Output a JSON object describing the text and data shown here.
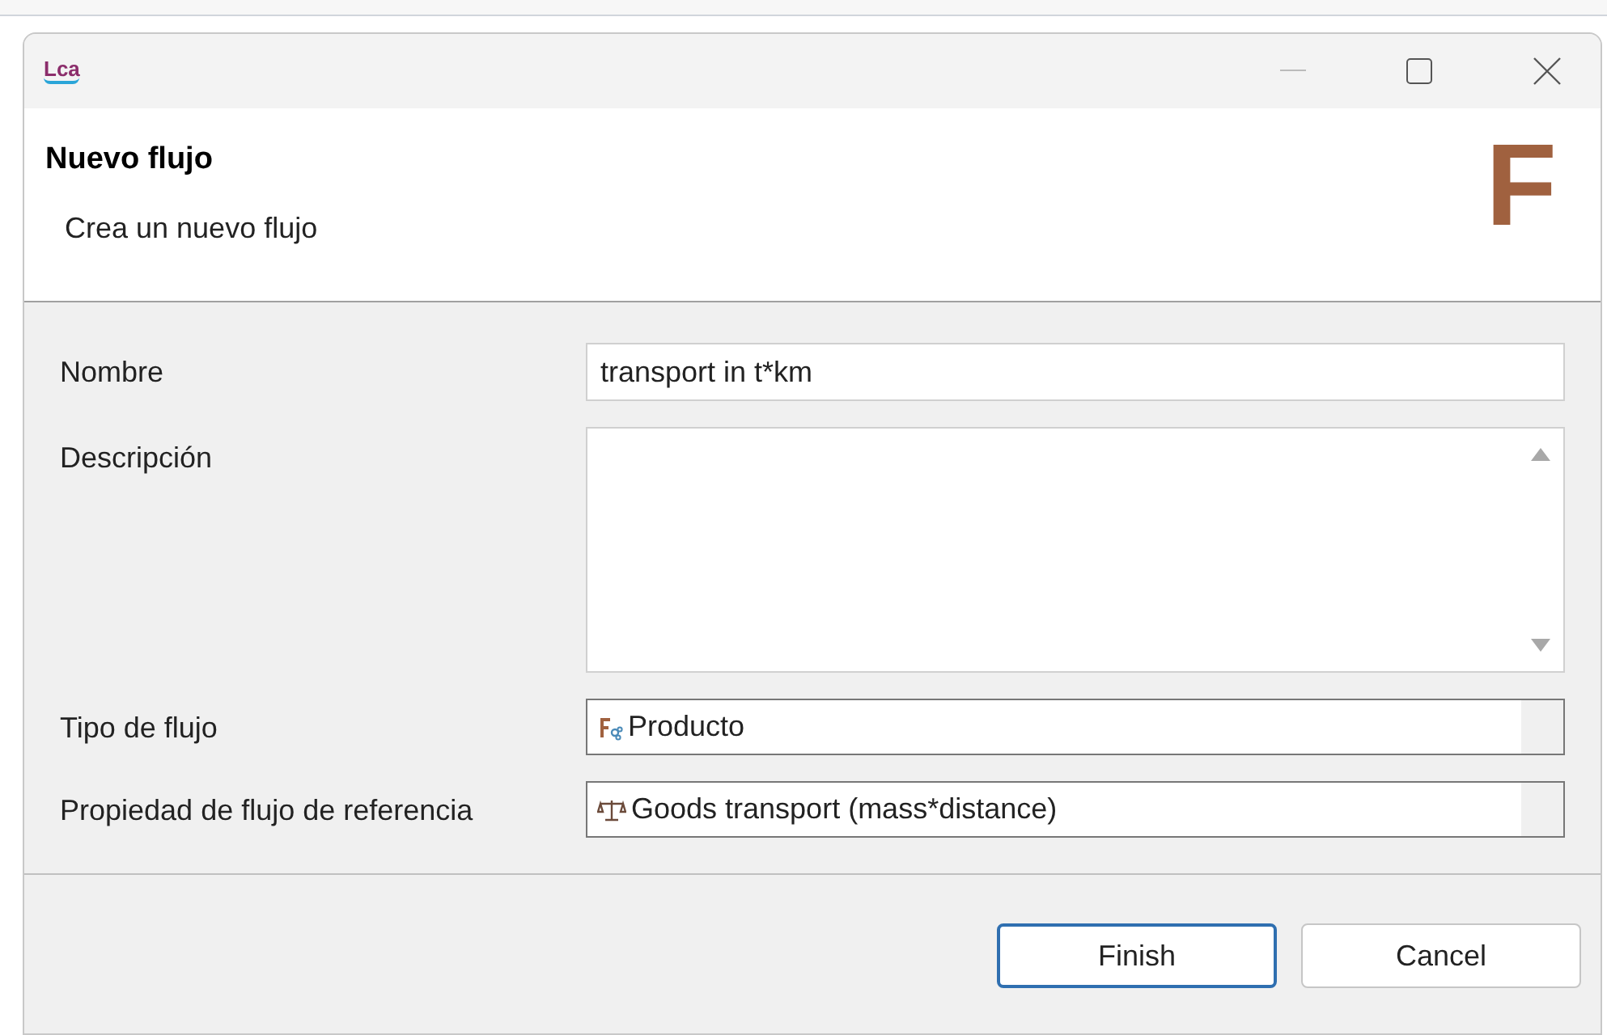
{
  "window": {
    "app_logo": "Lca"
  },
  "header": {
    "title": "Nuevo flujo",
    "subtitle": "Crea un nuevo flujo",
    "logo_letter": "F"
  },
  "fields": [
    {
      "kind": "text",
      "label": "Nombre",
      "value": "transport in t*km"
    },
    {
      "kind": "textarea",
      "label": "Descripción"
    },
    {
      "kind": "flow-type",
      "label": "Tipo de flujo",
      "value": "Producto"
    },
    {
      "kind": "flow-property",
      "label": "Propiedad de flujo de referencia",
      "value": "Goods transport (mass*distance)"
    }
  ],
  "buttons": [
    {
      "label": "Finish",
      "default": true
    },
    {
      "label": "Cancel",
      "default": false
    }
  ]
}
